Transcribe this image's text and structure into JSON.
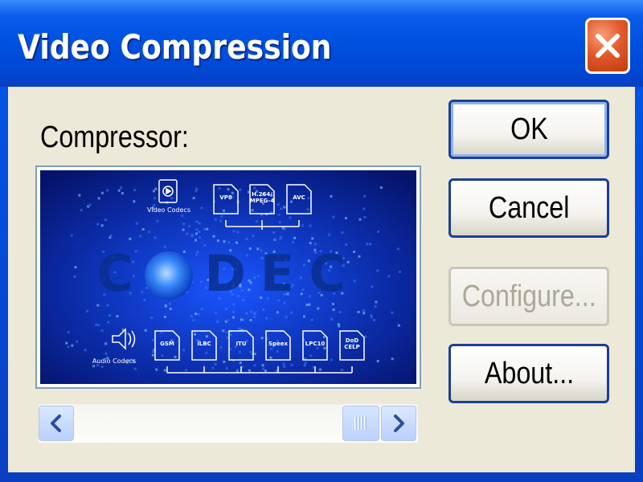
{
  "window": {
    "title": "Video Compression"
  },
  "compressor": {
    "label": "Compressor:"
  },
  "preview": {
    "video_label": "Video Codecs",
    "audio_label": "Audio Codecs",
    "big_text": "CODEC",
    "video_codecs": [
      "VP8",
      "H.264/ MPEG-4",
      "AVC"
    ],
    "audio_codecs": [
      "GSM",
      "iLBC",
      "ITU",
      "Speex",
      "LPC10",
      "DoD CELP"
    ]
  },
  "buttons": {
    "ok": "OK",
    "cancel": "Cancel",
    "configure": "Configure...",
    "about": "About..."
  },
  "colors": {
    "titlebar": "#0050e0",
    "client": "#ece9d8",
    "close": "#e2592e",
    "button_border": "#1c3f94"
  }
}
